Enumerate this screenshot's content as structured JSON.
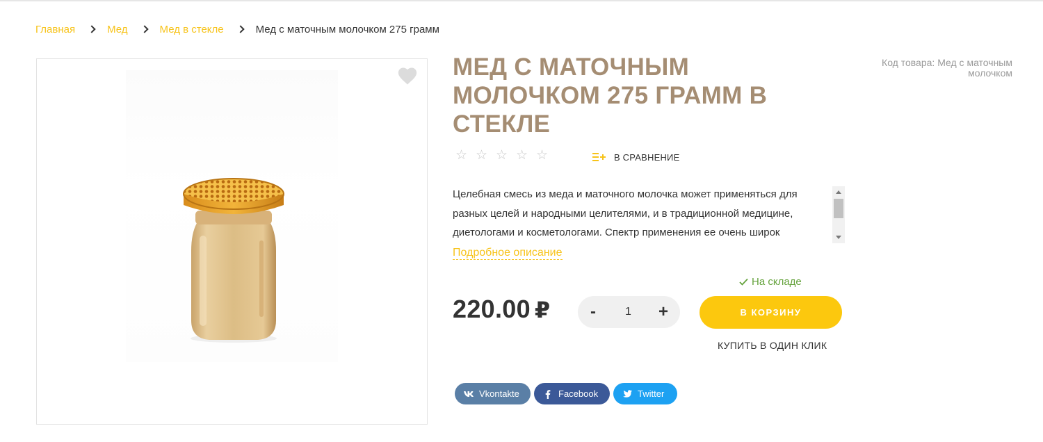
{
  "breadcrumb": {
    "items": [
      {
        "label": "Главная"
      },
      {
        "label": "Мед"
      },
      {
        "label": "Мед в стекле"
      }
    ],
    "current": "Мед с маточным молочком 275 грамм"
  },
  "product": {
    "title": "Мед с маточным молочком 275 грамм в стекле",
    "sku": "Код товара: Мед с маточным молочком",
    "rating_stars": 5,
    "rating_value": 0,
    "compare_label": "В сравнение",
    "description": "Целебная смесь из меда и маточного молочка может применяться для разных целей и народными целителями, и в традиционной медицине, диетологами и косметологами. Спектр применения ее очень широк",
    "more_link": "Подробное описание",
    "stock": "На складе",
    "price": "220.00",
    "currency": "₽",
    "quantity": "1",
    "qty_minus": "-",
    "qty_plus": "+",
    "cart_button": "В корзину",
    "one_click": "Купить в один клик"
  },
  "share": [
    {
      "label": "Vkontakte",
      "icon": "vk-icon",
      "color": "#5a7fa6"
    },
    {
      "label": "Facebook",
      "icon": "facebook-icon",
      "color": "#3b5998"
    },
    {
      "label": "Twitter",
      "icon": "twitter-icon",
      "color": "#1da1f2"
    }
  ],
  "colors": {
    "accent": "#fcc80e",
    "link": "#f7c31a",
    "title": "#a58d73",
    "stock": "#64a23b"
  }
}
